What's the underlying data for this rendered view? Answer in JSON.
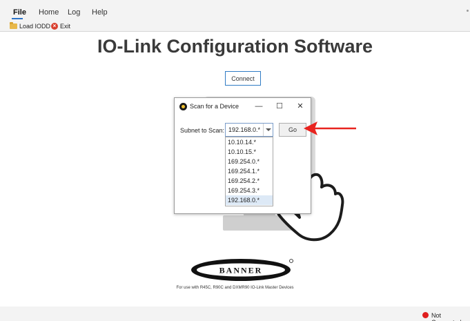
{
  "menu": {
    "items": [
      {
        "label": "File"
      },
      {
        "label": "Home"
      },
      {
        "label": "Log"
      },
      {
        "label": "Help"
      }
    ]
  },
  "toolbar": {
    "load_label": "Load IODD",
    "exit_label": "Exit",
    "load_icon": "folder-icon",
    "exit_icon": "close-circle-icon"
  },
  "page_title": "IO-Link Configuration Software",
  "connect_label": "Connect",
  "dialog": {
    "title": "Scan for a Device",
    "minimize_glyph": "—",
    "maximize_glyph": "☐",
    "close_glyph": "✕",
    "subnet_label": "Subnet to Scan:",
    "subnet_value": "192.168.0.*",
    "go_label": "Go",
    "options": [
      "10.10.14.*",
      "10.10.15.*",
      "169.254.0.*",
      "169.254.1.*",
      "169.254.2.*",
      "169.254.3.*",
      "192.168.0.*"
    ],
    "selected_option": "192.168.0.*"
  },
  "logo_text": "BANNER",
  "tagline": "For use with R45C, R90C and DXMR90 IO-Link Master Devices",
  "status": {
    "text": "Not Connected",
    "color": "#e01e1e"
  },
  "colors": {
    "accent": "#2a73c9",
    "annotation": "#e8231f"
  }
}
